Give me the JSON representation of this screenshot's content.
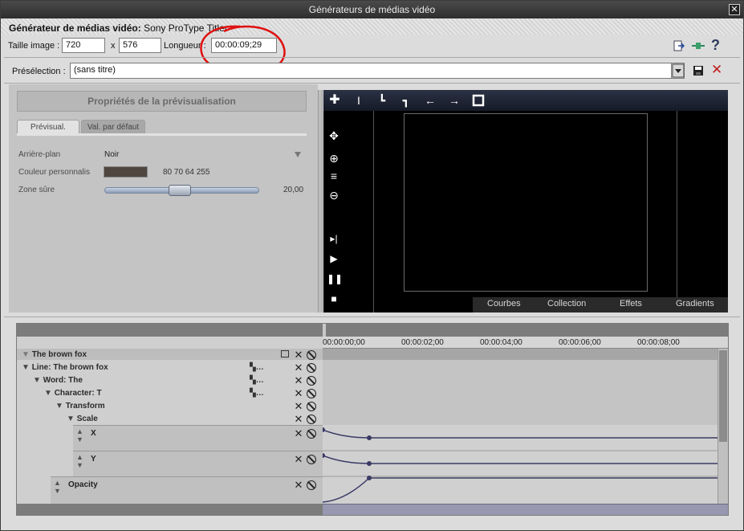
{
  "window": {
    "title": "Générateurs de médias vidéo",
    "close": "✕"
  },
  "generator": {
    "label": "Générateur de médias vidéo:",
    "name": "Sony ProType Titler"
  },
  "image_size": {
    "label": "Taille image :",
    "width": "720",
    "x": "x",
    "height": "576"
  },
  "length": {
    "label": "Longueur :",
    "value": "00:00:09;29"
  },
  "preset": {
    "label": "Présélection :",
    "value": "(sans titre)"
  },
  "preview_props": {
    "title": "Propriétés de la prévisualisation",
    "tabs": [
      "Prévisual.",
      "Val. par défaut"
    ],
    "background_label": "Arrière-plan",
    "background_value": "Noir",
    "custom_color_label": "Couleur personnalis",
    "custom_color_value": "80 70 64 255",
    "custom_color_hex": "#504640",
    "safe_zone_label": "Zone sûre",
    "safe_zone_value": "20,00",
    "safe_zone_fraction": 0.48
  },
  "preview_tabs": [
    "Courbes",
    "Collection",
    "Effets",
    "Gradients"
  ],
  "timeline": {
    "ticks": [
      "00:00:00;00",
      "00:00:02;00",
      "00:00:04;00",
      "00:00:06;00",
      "00:00:08;00"
    ],
    "tracks": [
      {
        "label": "The brown fox"
      },
      {
        "label": "Line: The brown fox"
      },
      {
        "label": "Word: The"
      },
      {
        "label": "Character: T"
      },
      {
        "label": "Transform"
      },
      {
        "label": "Scale"
      },
      {
        "label": "X"
      },
      {
        "label": "Y"
      },
      {
        "label": "Opacity"
      }
    ]
  },
  "colors": {
    "accent_circle": "#e01010",
    "curve": "#3a3a66"
  }
}
